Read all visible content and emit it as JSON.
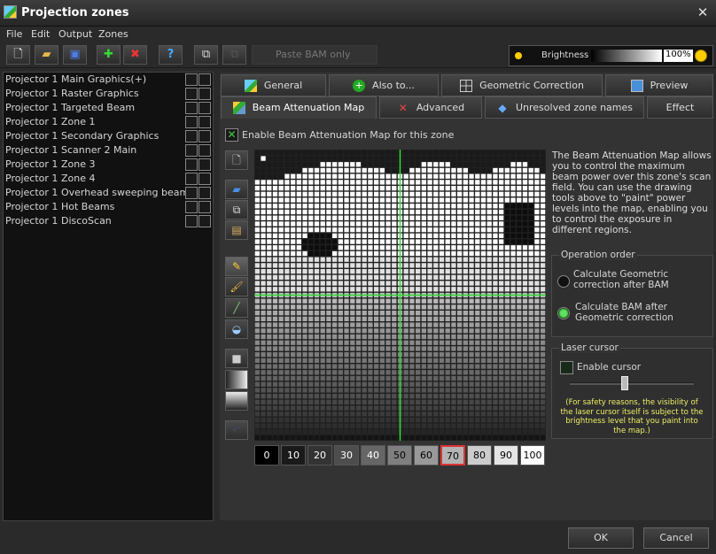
{
  "window": {
    "title": "Projection zones",
    "close_glyph": "✕"
  },
  "menu": [
    "File",
    "Edit",
    "Output",
    "Zones"
  ],
  "toolbar": {
    "paste_label": "Paste BAM only"
  },
  "brightness": {
    "label": "Brightness",
    "value": "100%"
  },
  "zones": [
    {
      "projector": "Projector 1",
      "name": "Main Graphics(+)"
    },
    {
      "projector": "Projector 1",
      "name": "Raster Graphics"
    },
    {
      "projector": "Projector 1",
      "name": "Targeted Beam"
    },
    {
      "projector": "Projector 1",
      "name": "Zone 1"
    },
    {
      "projector": "Projector 1",
      "name": "Secondary Graphics"
    },
    {
      "projector": "Projector 1",
      "name": "Scanner 2 Main"
    },
    {
      "projector": "Projector 1",
      "name": "Zone 3"
    },
    {
      "projector": "Projector 1",
      "name": "Zone 4"
    },
    {
      "projector": "Projector 1",
      "name": "Overhead sweeping beams"
    },
    {
      "projector": "Projector 1",
      "name": "Hot Beams"
    },
    {
      "projector": "Projector 1",
      "name": "DiscoScan"
    }
  ],
  "tabs_row1": [
    "General",
    "Also to...",
    "Geometric Correction",
    "Preview"
  ],
  "tabs_row2": [
    "Beam Attenuation Map",
    "Advanced",
    "Unresolved zone names",
    "Effect"
  ],
  "bam": {
    "enable_label": "Enable Beam Attenuation Map for this zone",
    "description": "The Beam Attenuation Map allows you to control the maximum beam power over this zone's scan field. You can use the drawing tools above to \"paint\" power levels into the map, enabling you to control the exposure in different regions.",
    "levels": [
      "0",
      "10",
      "20",
      "30",
      "40",
      "50",
      "60",
      "70",
      "80",
      "90",
      "100"
    ],
    "selected_level": "70"
  },
  "operation_order": {
    "title": "Operation order",
    "option1": "Calculate Geometric correction after BAM",
    "option2": "Calculate BAM after Geometric correction",
    "selected": 2
  },
  "laser_cursor": {
    "title": "Laser cursor",
    "enable_label": "Enable cursor",
    "note": "(For safety reasons, the visibility of the laser cursor itself is subject to the brightness level that you paint into the map.)"
  },
  "footer": {
    "ok": "OK",
    "cancel": "Cancel"
  },
  "colors": {
    "accent_green": "#33dd33",
    "selected_level_border": "#dd3333",
    "note_text": "#eeee66"
  }
}
